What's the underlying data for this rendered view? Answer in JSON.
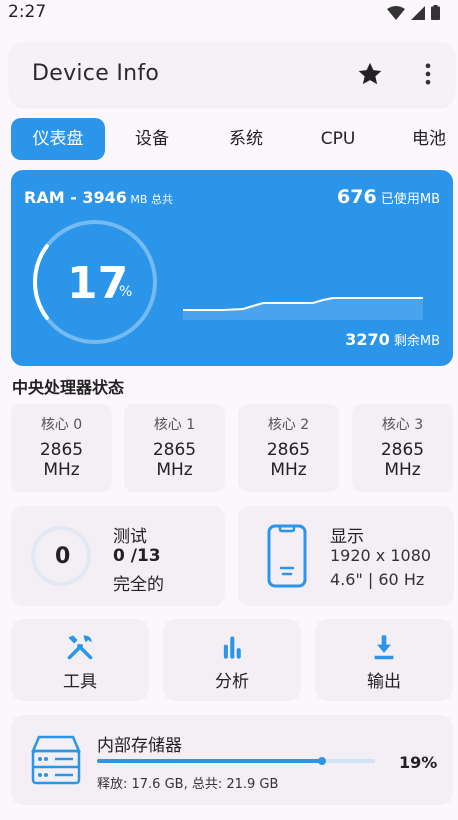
{
  "status_bar": {
    "time": "2:27"
  },
  "app_bar": {
    "title": "Device Info",
    "star_icon": "star-icon",
    "more_icon": "more-vert-icon"
  },
  "tabs": [
    {
      "label": "仪表盘",
      "active": true
    },
    {
      "label": "设备",
      "active": false
    },
    {
      "label": "系统",
      "active": false
    },
    {
      "label": "CPU",
      "active": false
    },
    {
      "label": "电池",
      "active": false
    }
  ],
  "ram": {
    "prefix": "RAM - ",
    "total_value": "3946",
    "total_unit": " MB 总共",
    "used_value": "676",
    "used_unit": " 已使用MB",
    "free_value": "3270",
    "free_unit": " 剩余MB",
    "percent": "17",
    "percent_sign": "%",
    "percent_fraction": 0.17
  },
  "cpu": {
    "section_title": "中央处理器状态",
    "cores": [
      {
        "label": "核心 0",
        "freq": "2865",
        "unit": "MHz"
      },
      {
        "label": "核心 1",
        "freq": "2865",
        "unit": "MHz"
      },
      {
        "label": "核心 2",
        "freq": "2865",
        "unit": "MHz"
      },
      {
        "label": "核心 3",
        "freq": "2865",
        "unit": "MHz"
      }
    ]
  },
  "test": {
    "value": "0",
    "title": "测试",
    "count": "0 /13",
    "status": "完全的"
  },
  "display": {
    "title": "显示",
    "resolution": "1920 x 1080",
    "spec": "4.6\" | 60 Hz"
  },
  "actions": [
    {
      "label": "工具",
      "icon": "tools-icon"
    },
    {
      "label": "分析",
      "icon": "analytics-icon"
    },
    {
      "label": "输出",
      "icon": "download-icon"
    }
  ],
  "storage": {
    "title": "内部存储器",
    "subtitle": "释放: 17.6 GB,  总共: 21.9 GB",
    "percent": "19%",
    "used_fraction": 0.19
  },
  "colors": {
    "accent": "#2b95ea",
    "card": "#f3eff4",
    "background": "#fbf7fc"
  }
}
